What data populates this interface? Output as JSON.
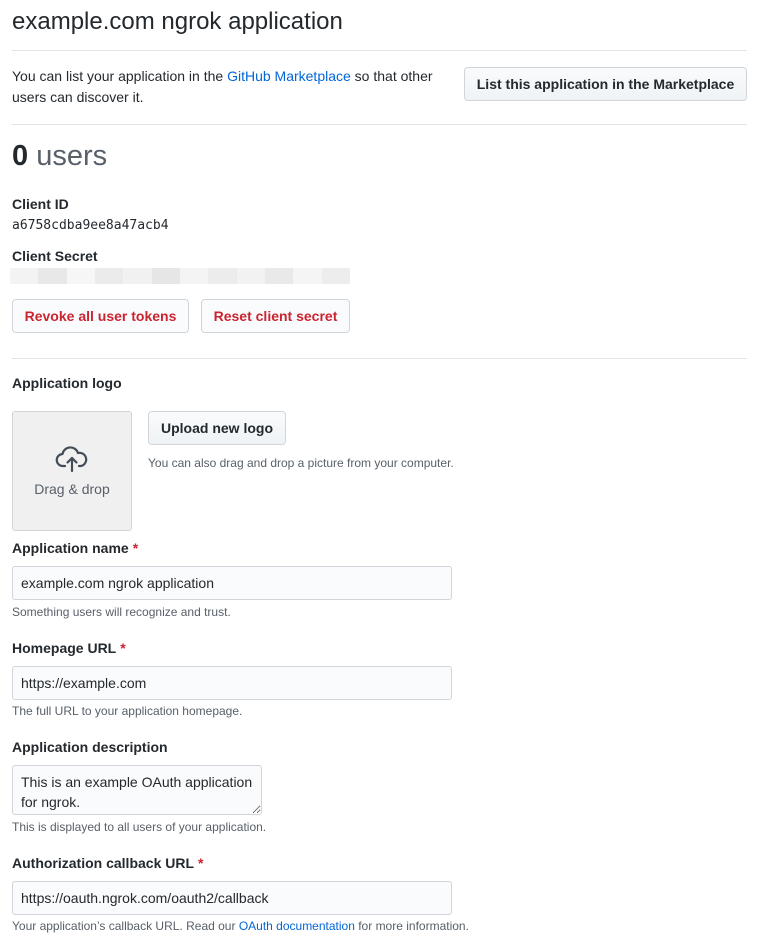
{
  "page": {
    "title": "example.com ngrok application"
  },
  "marketplace": {
    "text_before": "You can list your application in the ",
    "link_text": "GitHub Marketplace",
    "text_after": " so that other users can discover it.",
    "button_label": "List this application in the Marketplace"
  },
  "users": {
    "count": "0",
    "label": " users"
  },
  "credentials": {
    "client_id_label": "Client ID",
    "client_id_value": "a6758cdba9ee8a47acb4",
    "client_secret_label": "Client Secret",
    "revoke_button": "Revoke all user tokens",
    "reset_button": "Reset client secret"
  },
  "logo": {
    "label": "Application logo",
    "dropzone_text": "Drag & drop",
    "upload_button": "Upload new logo",
    "note": "You can also drag and drop a picture from your computer."
  },
  "form": {
    "required_marker": "*",
    "app_name": {
      "label": "Application name",
      "value": "example.com ngrok application",
      "note": "Something users will recognize and trust."
    },
    "homepage": {
      "label": "Homepage URL",
      "value": "https://example.com",
      "note": "The full URL to your application homepage."
    },
    "description": {
      "label": "Application description",
      "value": "This is an example OAuth application for ngrok.",
      "note": "This is displayed to all users of your application."
    },
    "callback": {
      "label": "Authorization callback URL",
      "value": "https://oauth.ngrok.com/oauth2/callback",
      "note_before": "Your application’s callback URL. Read our ",
      "note_link": "OAuth documentation",
      "note_after": " for more information."
    }
  },
  "colors": {
    "link": "#0366d6",
    "danger": "#cb2431",
    "border": "#d1d5da"
  }
}
